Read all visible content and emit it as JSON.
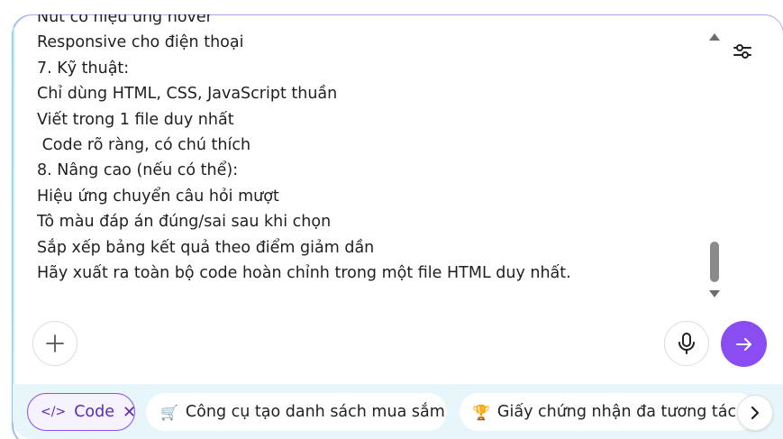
{
  "composer": {
    "lines": [
      "Nút có hiệu ứng hover",
      "Responsive cho điện thoại",
      "7. Kỹ thuật:",
      "Chỉ dùng HTML, CSS, JavaScript thuần",
      "Viết trong 1 file duy nhất",
      " Code rõ ràng, có chú thích",
      "8. Nâng cao (nếu có thể):",
      "Hiệu ứng chuyển câu hỏi mượt",
      "Tô màu đáp án đúng/sai sau khi chọn",
      "Sắp xếp bảng kết quả theo điểm giảm dần",
      "Hãy xuất ra toàn bộ code hoàn chỉnh trong một file HTML duy nhất."
    ]
  },
  "icons": {
    "settings": "sliders-icon",
    "plus": "plus-icon",
    "mic": "microphone-icon",
    "send": "arrow-right-icon",
    "next": "chevron-right-icon"
  },
  "chips": [
    {
      "glyph": "</>",
      "label": "Code",
      "close": "✕"
    },
    {
      "emoji": "🛒",
      "label": "Công cụ tạo danh sách mua sắm"
    },
    {
      "emoji": "🏆",
      "label": "Giấy chứng nhận đa tương tác"
    }
  ],
  "colors": {
    "accent": "#8a4df2",
    "chip_bar": "#e6f6fb",
    "border": "#b9a3f0"
  }
}
